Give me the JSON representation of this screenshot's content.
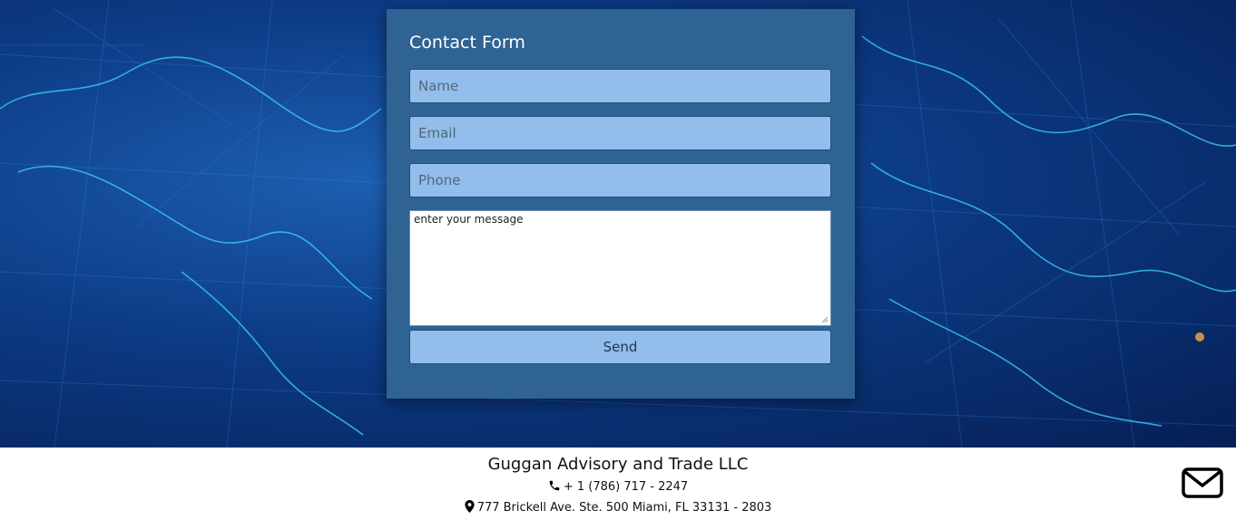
{
  "form": {
    "title": "Contact Form",
    "name_placeholder": "Name",
    "email_placeholder": "Email",
    "phone_placeholder": "Phone",
    "message_placeholder": "enter your message",
    "send_label": "Send"
  },
  "footer": {
    "company": "Guggan Advisory and Trade LLC",
    "phone": "+ 1 (786) 717 - 2247",
    "address": "777 Brickell Ave. Ste. 500 Miami, FL 33131 - 2803"
  },
  "icons": {
    "phone": "phone-icon",
    "location": "map-marker-icon",
    "mail": "envelope-icon"
  },
  "colors": {
    "form_background": "#2e6393",
    "input_background": "#93bdea",
    "hero_background": "#0c3a84"
  }
}
